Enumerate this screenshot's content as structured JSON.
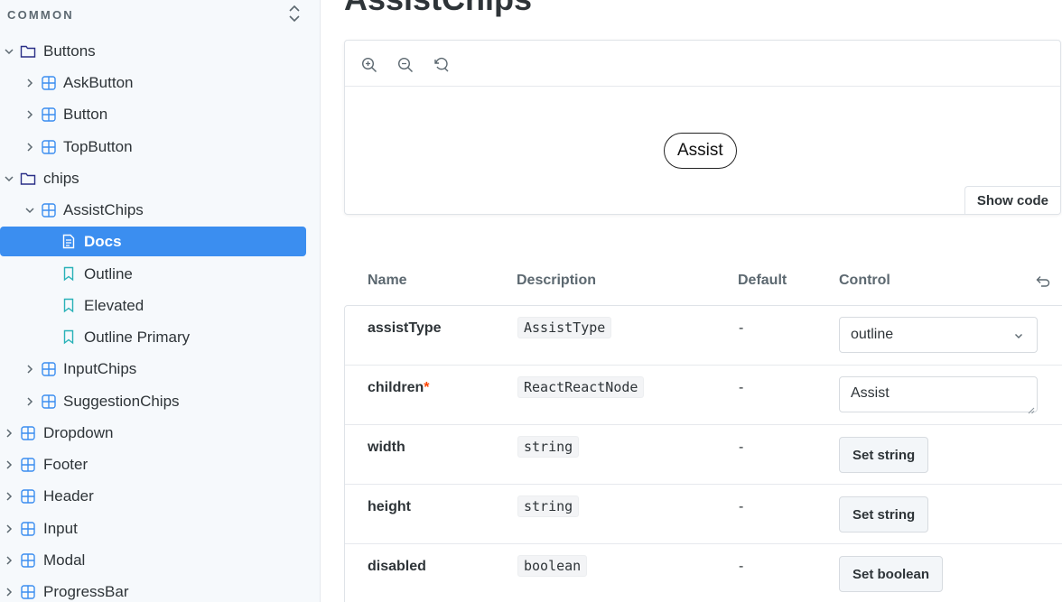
{
  "sidebar": {
    "section_title": "COMMON",
    "items": [
      {
        "label": "Buttons",
        "icon": "folder-icon",
        "expanded": true
      },
      {
        "label": "AskButton",
        "icon": "component-icon"
      },
      {
        "label": "Button",
        "icon": "component-icon"
      },
      {
        "label": "TopButton",
        "icon": "component-icon"
      },
      {
        "label": "chips",
        "icon": "folder-icon",
        "expanded": true
      },
      {
        "label": "AssistChips",
        "icon": "component-icon",
        "expanded": true
      },
      {
        "label": "Docs",
        "icon": "document-icon",
        "selected": true
      },
      {
        "label": "Outline",
        "icon": "bookmark-icon"
      },
      {
        "label": "Elevated",
        "icon": "bookmark-icon"
      },
      {
        "label": "Outline Primary",
        "icon": "bookmark-icon"
      },
      {
        "label": "InputChips",
        "icon": "component-icon"
      },
      {
        "label": "SuggestionChips",
        "icon": "component-icon"
      },
      {
        "label": "Dropdown",
        "icon": "component-icon"
      },
      {
        "label": "Footer",
        "icon": "component-icon"
      },
      {
        "label": "Header",
        "icon": "component-icon"
      },
      {
        "label": "Input",
        "icon": "component-icon"
      },
      {
        "label": "Modal",
        "icon": "component-icon"
      },
      {
        "label": "ProgressBar",
        "icon": "component-icon"
      }
    ]
  },
  "main": {
    "title": "AssistChips",
    "preview": {
      "chip_label": "Assist",
      "show_code_label": "Show code",
      "toolbar": [
        "zoom-in-icon",
        "zoom-out-icon",
        "reset-zoom-icon"
      ]
    },
    "args_table": {
      "headers": {
        "name": "Name",
        "description": "Description",
        "default": "Default",
        "control": "Control"
      },
      "rows": [
        {
          "name": "assistType",
          "type": "AssistType",
          "default": "-",
          "control": "select",
          "value": "outline"
        },
        {
          "name": "children",
          "required_mark": "*",
          "type": "ReactReactNode",
          "default": "-",
          "control": "textarea",
          "value": "Assist"
        },
        {
          "name": "width",
          "type": "string",
          "default": "-",
          "control": "button",
          "value": "Set string"
        },
        {
          "name": "height",
          "type": "string",
          "default": "-",
          "control": "button",
          "value": "Set string"
        },
        {
          "name": "disabled",
          "type": "boolean",
          "default": "-",
          "control": "button",
          "value": "Set boolean"
        }
      ]
    }
  },
  "colors": {
    "accent": "#3b8ef0",
    "component_icon": "#3b8ef0",
    "bookmark_icon": "#29b2b8",
    "folder_icon": "#2a2f87",
    "required": "#ff4400"
  }
}
